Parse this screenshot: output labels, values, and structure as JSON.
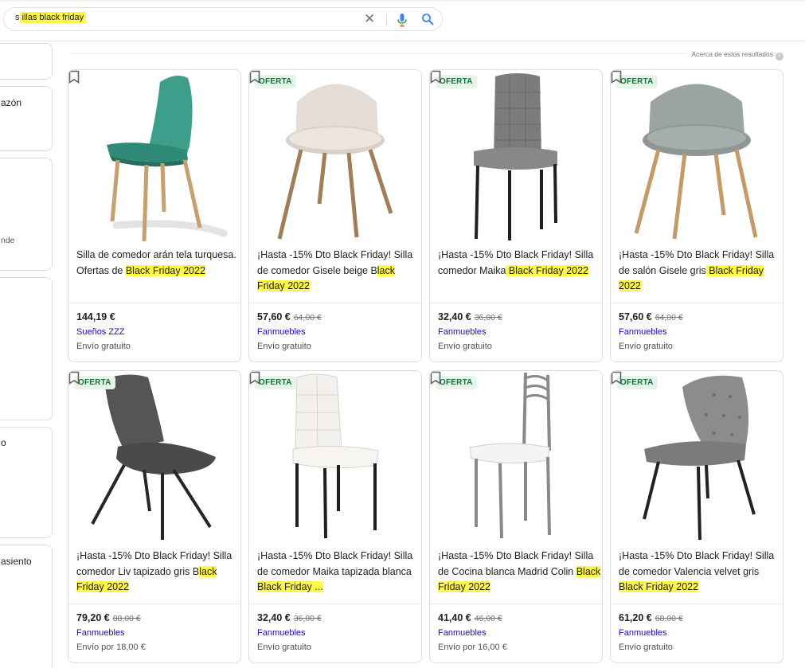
{
  "search": {
    "query_prefix": "s",
    "query_highlight": "illas black friday"
  },
  "about_results": "Acerca de estos resultados",
  "left_panel": {
    "texts": [
      "azón",
      "nde",
      "o",
      "asiento"
    ]
  },
  "products": [
    {
      "badge": "",
      "title_plain": "Silla de comedor arán tela turquesa. Ofertas de ",
      "title_highlight": "Black Friday 2022",
      "price": "144,19 €",
      "old_price": "",
      "seller": "Sueños ZZZ",
      "shipping": "Envío gratuito"
    },
    {
      "badge": "OFERTA",
      "title_plain": "¡Hasta -15% Dto Black Friday! Silla de comedor Gisele beige B",
      "title_highlight": "lack Friday 2022",
      "price": "57,60 €",
      "old_price": "64,00 €",
      "seller": "Fanmuebles",
      "shipping": "Envío gratuito"
    },
    {
      "badge": "OFERTA",
      "title_plain": "¡Hasta -15% Dto Black Friday! Silla comedor Maika",
      "title_highlight": " Black Friday 2022",
      "price": "32,40 €",
      "old_price": "36,00 €",
      "seller": "Fanmuebles",
      "shipping": "Envío gratuito"
    },
    {
      "badge": "OFERTA",
      "title_plain": "¡Hasta -15% Dto Black Friday! Silla de salón Gisele gris",
      "title_highlight": " Black Friday 2022",
      "price": "57,60 €",
      "old_price": "64,00 €",
      "seller": "Fanmuebles",
      "shipping": "Envío gratuito"
    },
    {
      "badge": "OFERTA",
      "title_plain": "¡Hasta -15% Dto Black Friday! Silla comedor Liv tapizado gris B",
      "title_highlight": "lack Friday 2022",
      "price": "79,20 €",
      "old_price": "88,00 €",
      "seller": "Fanmuebles",
      "shipping": "Envío por 18,00 €"
    },
    {
      "badge": "OFERTA",
      "title_plain": "¡Hasta -15% Dto Black Friday! Silla de comedor Maika tapizada blanca ",
      "title_highlight": "Black Friday ...",
      "price": "32,40 €",
      "old_price": "36,00 €",
      "seller": "Fanmuebles",
      "shipping": "Envío gratuito"
    },
    {
      "badge": "OFERTA",
      "title_plain": "¡Hasta -15% Dto Black Friday! Silla de Cocina blanca Madrid Colin ",
      "title_highlight": "Black Friday 2022",
      "price": "41,40 €",
      "old_price": "46,00 €",
      "seller": "Fanmuebles",
      "shipping": "Envío por 16,00 €"
    },
    {
      "badge": "OFERTA",
      "title_plain": "¡Hasta -15% Dto Black Friday! Silla de comedor Valencia velvet gris ",
      "title_highlight": "Black Friday 2022",
      "price": "61,20 €",
      "old_price": "68,00 €",
      "seller": "Fanmuebles",
      "shipping": "Envío gratuito"
    }
  ]
}
